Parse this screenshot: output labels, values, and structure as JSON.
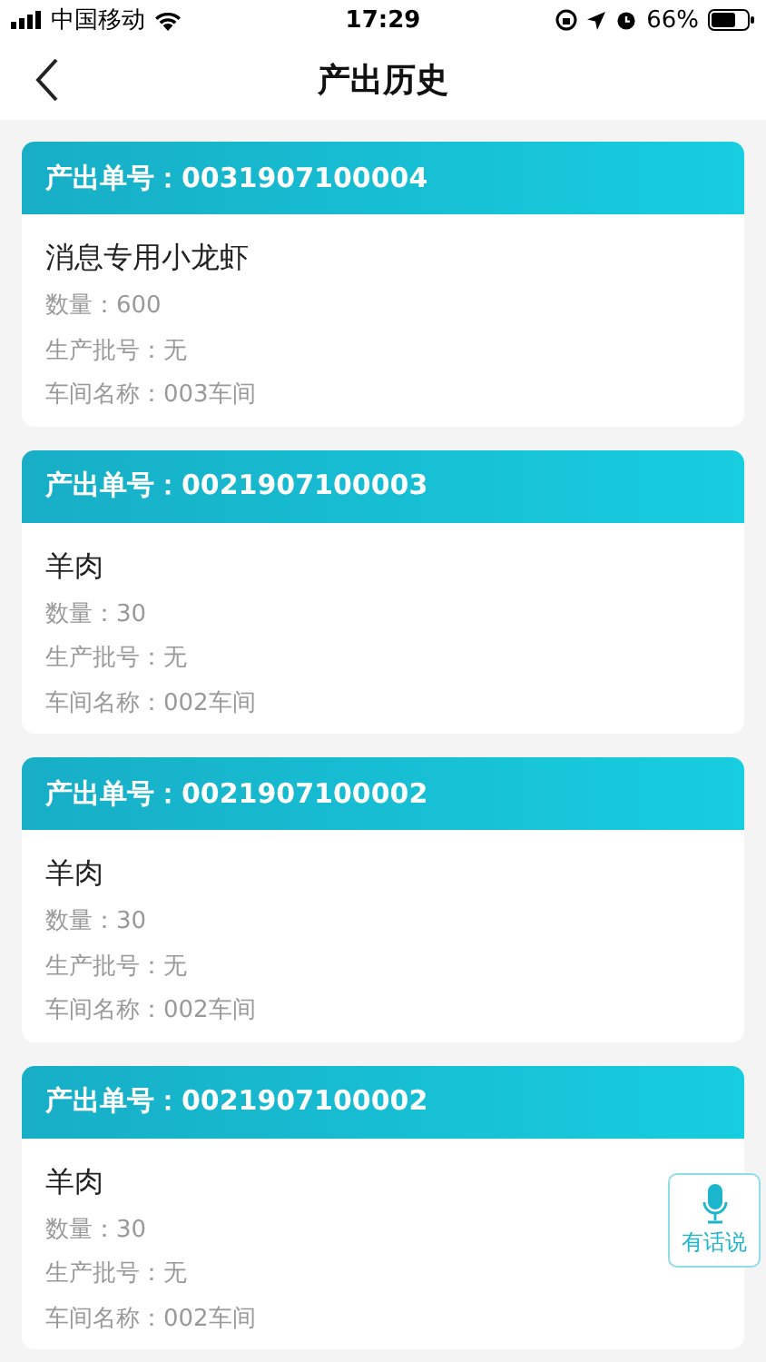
{
  "status_bar": {
    "carrier": "中国移动",
    "time": "17:29",
    "battery": "66%"
  },
  "nav": {
    "title": "产出历史"
  },
  "records": [
    {
      "order_label": "产出单号：",
      "order_no": "0031907100004",
      "product": "消息专用小龙虾",
      "fields": [
        "数量：600",
        "生产批号：无",
        "车间名称：003车间"
      ]
    },
    {
      "order_label": "产出单号：",
      "order_no": "0021907100003",
      "product": "羊肉",
      "fields": [
        "数量：30",
        "生产批号：无",
        "车间名称：002车间"
      ]
    },
    {
      "order_label": "产出单号：",
      "order_no": "0021907100002",
      "product": "羊肉",
      "fields": [
        "数量：30",
        "生产批号：无",
        "车间名称：002车间"
      ]
    },
    {
      "order_label": "产出单号：",
      "order_no": "0021907100002",
      "product": "羊肉",
      "fields": [
        "数量：30",
        "生产批号：无",
        "车间名称：002车间"
      ]
    }
  ],
  "voice_button": {
    "label": "有话说"
  }
}
